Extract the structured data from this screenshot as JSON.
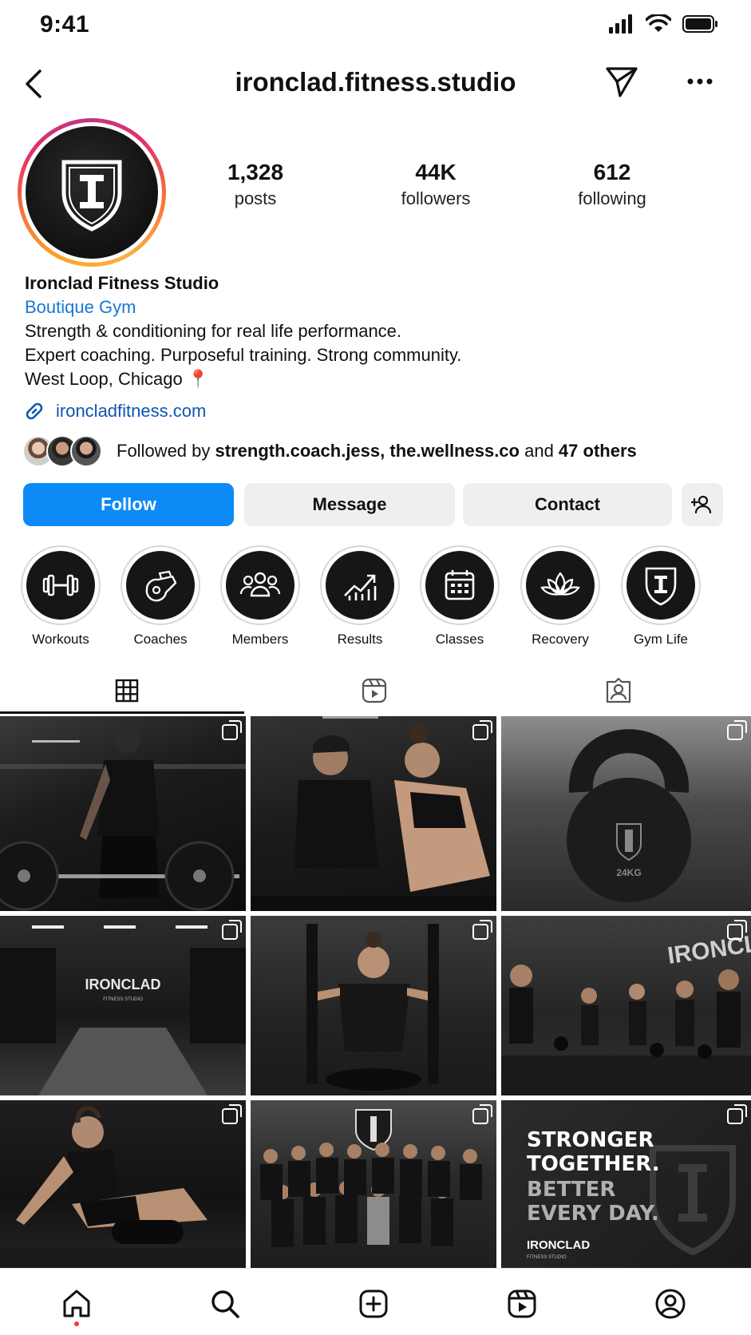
{
  "status_bar": {
    "time": "9:41"
  },
  "header": {
    "username": "ironclad.fitness.studio"
  },
  "profile": {
    "stats": [
      {
        "value": "1,328",
        "label": "posts"
      },
      {
        "value": "44K",
        "label": "followers"
      },
      {
        "value": "612",
        "label": "following"
      }
    ],
    "name": "Ironclad Fitness Studio",
    "category": "Boutique Gym",
    "bio_lines": [
      "Strength & conditioning for real life performance.",
      "Expert coaching. Purposeful training. Strong community.",
      "West Loop, Chicago 📍"
    ],
    "link": "ironcladfitness.com",
    "followed_by": {
      "prefix": "Followed by ",
      "names": "strength.coach.jess, the.wellness.co",
      "conjunction": " and ",
      "others": "47 others"
    }
  },
  "actions": {
    "follow": "Follow",
    "message": "Message",
    "contact": "Contact"
  },
  "highlights": [
    {
      "label": "Workouts",
      "icon": "dumbbell-icon"
    },
    {
      "label": "Coaches",
      "icon": "whistle-icon"
    },
    {
      "label": "Members",
      "icon": "people-icon"
    },
    {
      "label": "Results",
      "icon": "chart-icon"
    },
    {
      "label": "Classes",
      "icon": "calendar-icon"
    },
    {
      "label": "Recovery",
      "icon": "lotus-icon"
    },
    {
      "label": "Gym Life",
      "icon": "shield-icon"
    }
  ],
  "tabs": [
    {
      "icon": "grid-icon",
      "active": true
    },
    {
      "icon": "reels-icon",
      "active": false
    },
    {
      "icon": "tagged-icon",
      "active": false
    }
  ],
  "posts": {
    "tile_3_text": "24KG",
    "tile_4_text": "IRONCLAD",
    "tile_4_sub": "FITNESS STUDIO",
    "tile_6_text": "IRONCLA",
    "tile_9_lines": [
      "STRONGER",
      "TOGETHER.",
      "BETTER",
      "EVERY DAY."
    ],
    "tile_9_brand": "IRONCLAD",
    "tile_9_sub": "FITNESS STUDIO"
  },
  "bottom_nav": [
    {
      "icon": "home-icon"
    },
    {
      "icon": "search-icon"
    },
    {
      "icon": "create-icon"
    },
    {
      "icon": "reels-icon"
    },
    {
      "icon": "profile-icon"
    }
  ],
  "colors": {
    "follow_button": "#0d8af6",
    "link": "#0f55b3",
    "category": "#1877d8",
    "notification_dot": "#ff3040"
  }
}
